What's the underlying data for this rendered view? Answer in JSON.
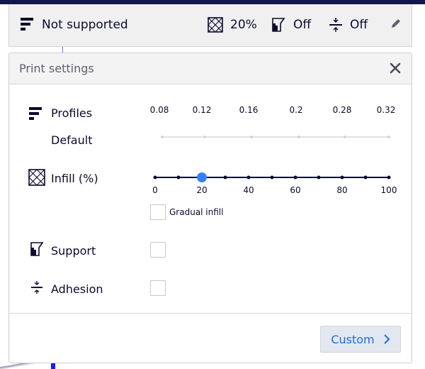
{
  "header": {
    "profile_label": "Not supported",
    "infill_label": "20%",
    "support_label": "Off",
    "adhesion_label": "Off"
  },
  "panel": {
    "title": "Print settings",
    "profiles": {
      "label": "Profiles",
      "current": "Default",
      "layer_heights": [
        "0.08",
        "0.12",
        "0.16",
        "0.2",
        "0.28",
        "0.32"
      ]
    },
    "infill": {
      "label": "Infill (%)",
      "tick_labels": [
        "0",
        "20",
        "40",
        "60",
        "80",
        "100"
      ],
      "value": 20,
      "gradual_label": "Gradual infill",
      "gradual_checked": false
    },
    "support": {
      "label": "Support",
      "checked": false
    },
    "adhesion": {
      "label": "Adhesion",
      "checked": false
    },
    "custom_button": "Custom"
  },
  "colors": {
    "accent": "#3282ff",
    "text": "#0a0a2e",
    "button_text": "#1a6ee0"
  }
}
